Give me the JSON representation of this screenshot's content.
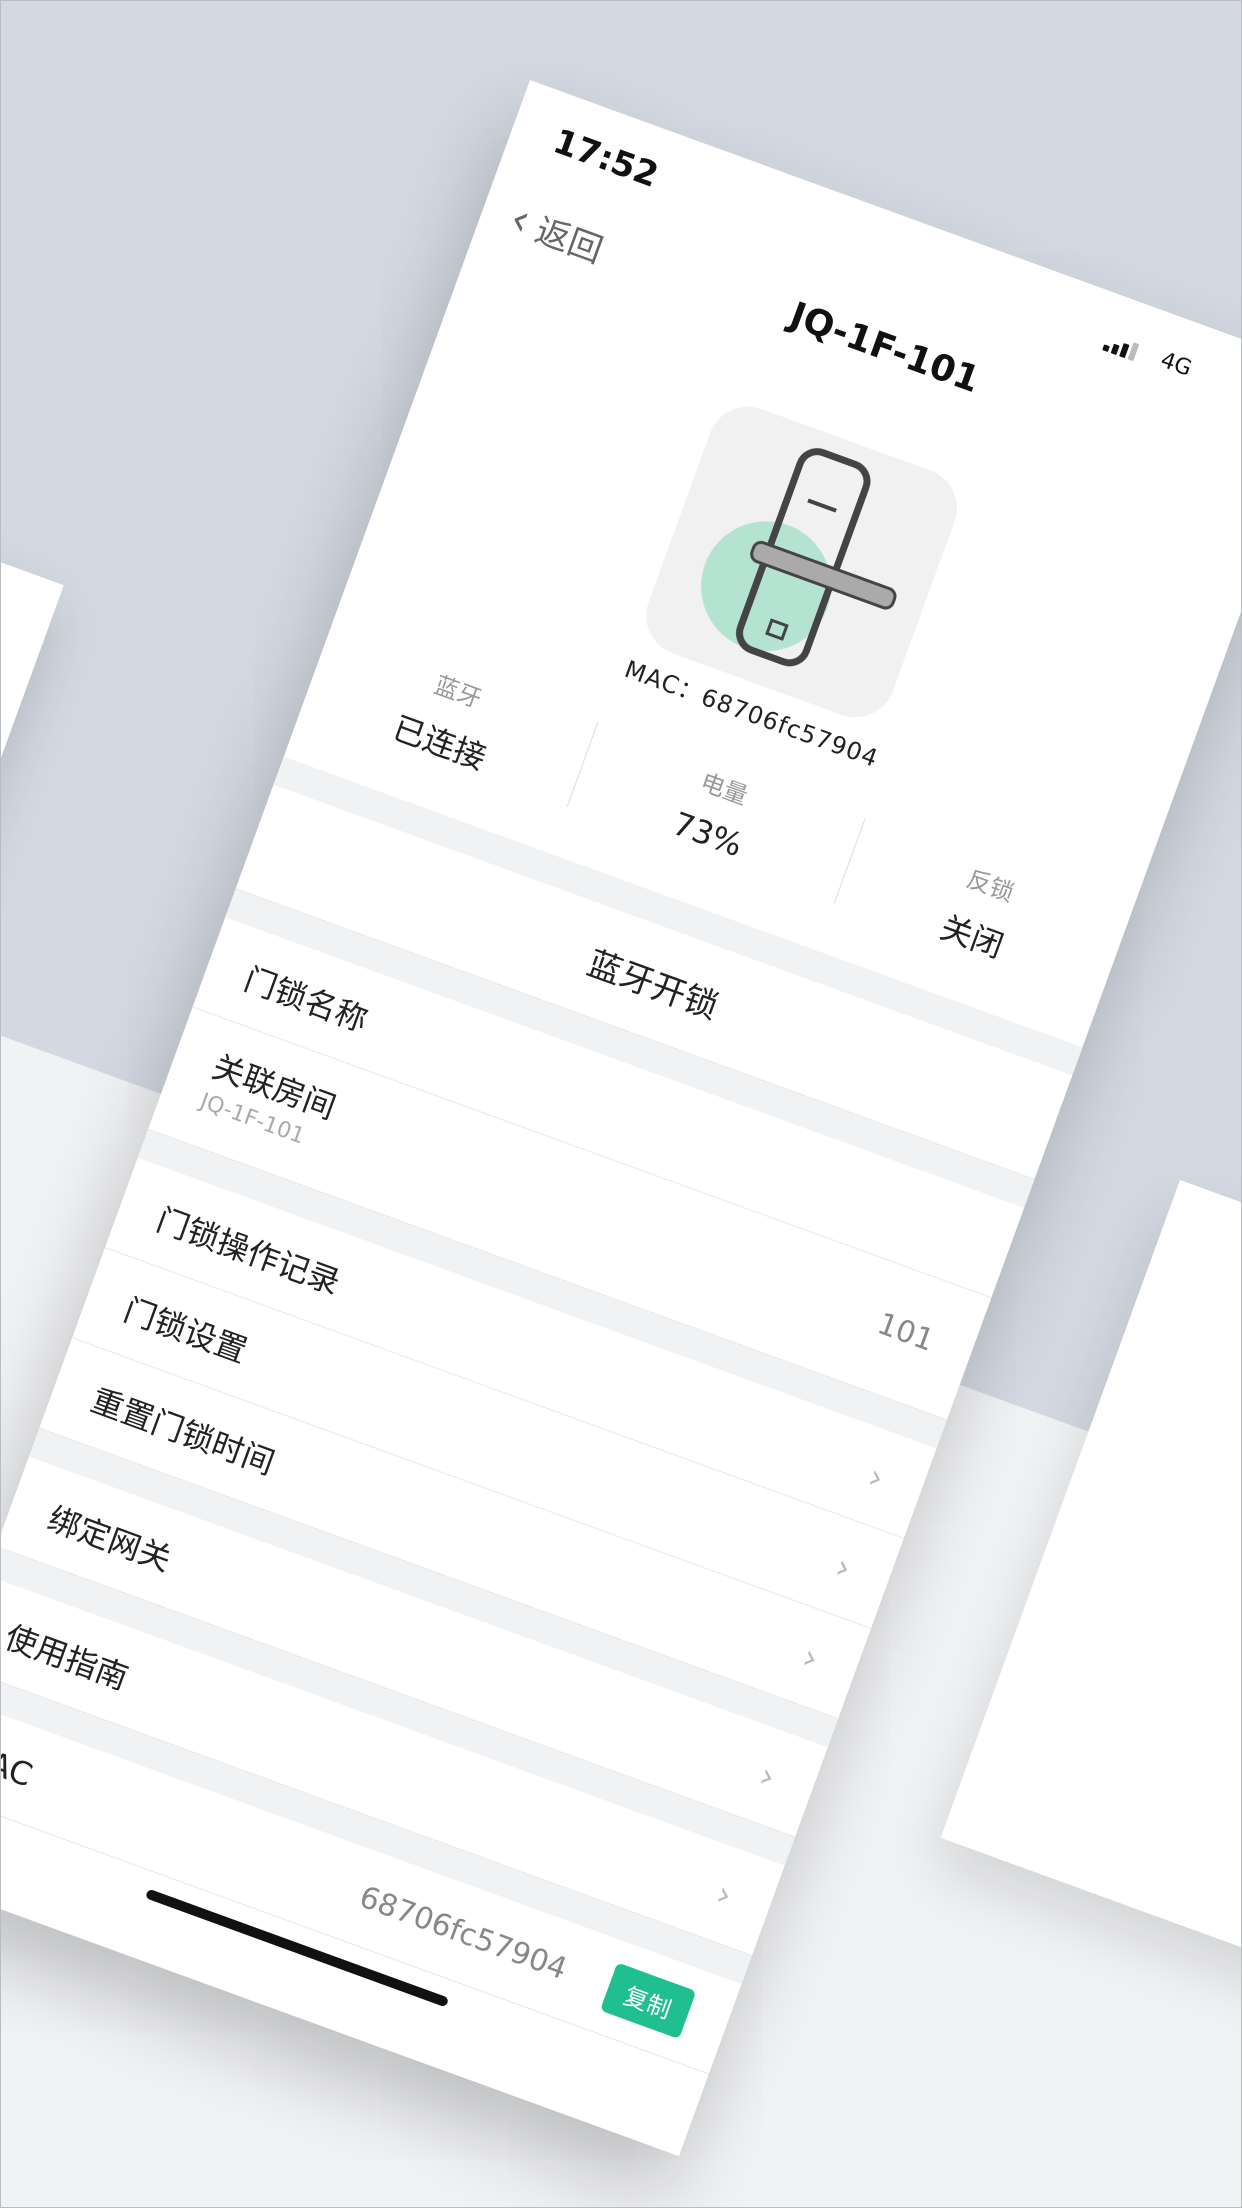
{
  "status_bar": {
    "time": "17:52",
    "network": "4G"
  },
  "nav": {
    "back_label": "返回",
    "title": "JQ-1F-101"
  },
  "device": {
    "mac_label": "MAC：68706fc57904"
  },
  "stats": [
    {
      "label": "蓝牙",
      "value": "已连接"
    },
    {
      "label": "电量",
      "value": "73%"
    },
    {
      "label": "反锁",
      "value": "关闭"
    }
  ],
  "actions": {
    "unlock_label": "蓝牙开锁"
  },
  "settings": {
    "lock_name_label": "门锁名称",
    "room_label": "关联房间",
    "room_sub": "JQ-1F-101",
    "room_value": "101",
    "op_records_label": "门锁操作记录",
    "lock_settings_label": "门锁设置",
    "reset_time_label": "重置门锁时间",
    "bind_gateway_label": "绑定网关",
    "guide_label": "使用指南",
    "mac_label": "MAC",
    "mac_value": "68706fc57904",
    "copy_label": "复制"
  },
  "colors": {
    "accent": "#1fbf8f",
    "background": "#d3d8e2"
  }
}
